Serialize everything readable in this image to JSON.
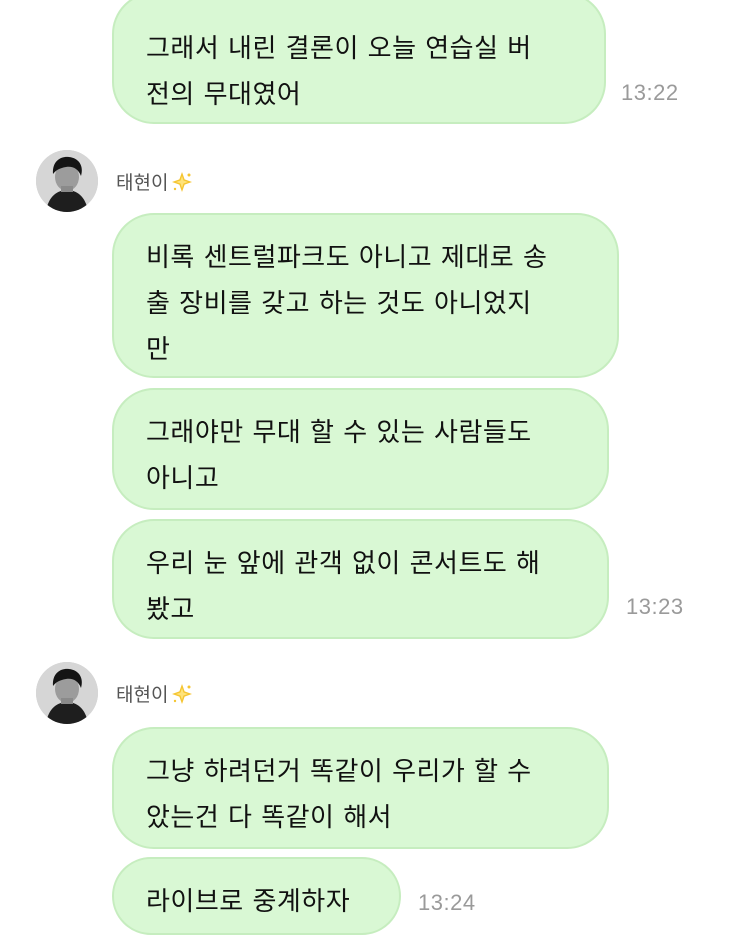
{
  "messages": [
    {
      "text": "그래서 내린 결론이 오늘 연습실 버\n전의 무대였어",
      "time": "13:22"
    },
    {
      "text": "비록 센트럴파크도 아니고 제대로 송\n출 장비를 갖고 하는 것도 아니었지\n만"
    },
    {
      "text": "그래야만 무대 할 수 있는 사람들도\n아니고"
    },
    {
      "text": "우리 눈 앞에 관객 없이 콘서트도 해\n봤고",
      "time": "13:23"
    },
    {
      "text": "그냥 하려던거 똑같이 우리가 할 수\n았는건 다 똑같이 해서"
    },
    {
      "text": "라이브로 중계하자",
      "time": "13:24"
    }
  ],
  "senders": [
    {
      "name": "태현이",
      "badge_icon": "sparkle-star-icon"
    },
    {
      "name": "태현이",
      "badge_icon": "sparkle-star-icon"
    }
  ],
  "colors": {
    "bubble_fill": "#d9f8d4",
    "bubble_border": "#c6edbf",
    "time_text": "#9a9a9a",
    "star": "#f5c532"
  }
}
